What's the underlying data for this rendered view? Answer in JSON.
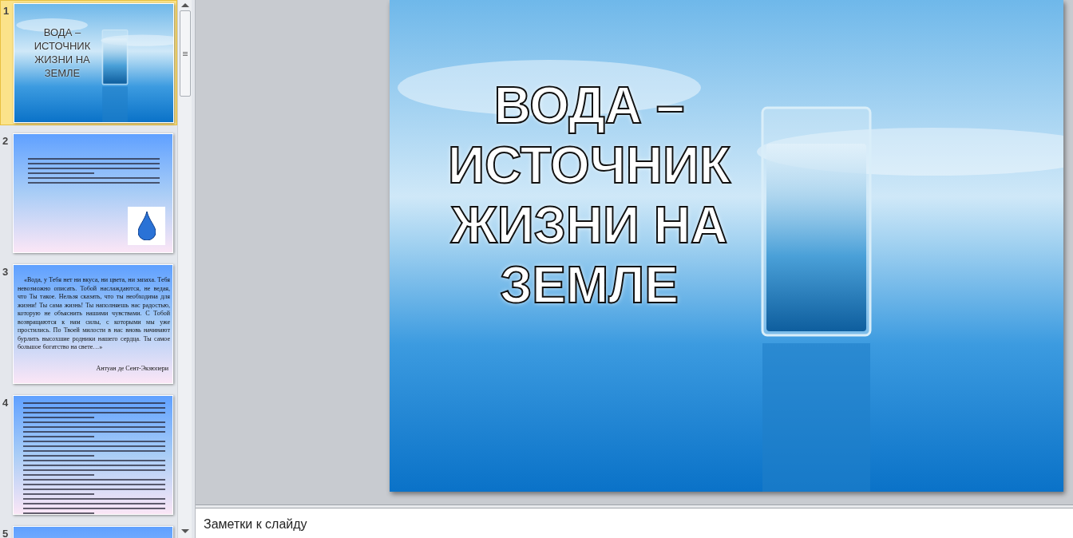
{
  "slides": [
    {
      "number": "1",
      "selected": true,
      "kind": "title",
      "title_lines": [
        "ВОДА –",
        "ИСТОЧНИК",
        "ЖИЗНИ НА",
        "ЗЕМЛЕ"
      ]
    },
    {
      "number": "2",
      "selected": false,
      "kind": "goals"
    },
    {
      "number": "3",
      "selected": false,
      "kind": "quote",
      "quote": "«Вода, у Тебя нет ни вкуса, ни цвета, ни запаха. Тебя невозможно описать. Тобой наслаждаются, не ведая, что Ты такое. Нельзя сказать, что ты необходима для жизни! Ты сама жизнь! Ты наполняешь нас радостью, которую не объяснить нашими чувствами. С Тобой возвращаются к нам силы, с которыми мы уже простились. По Твоей милости в нас вновь начинают бурлить высохшие родники нашего сердца. Ты самое большое богатство на свете…»",
      "author": "Антуан де Сент-Экзюпери"
    },
    {
      "number": "4",
      "selected": false,
      "kind": "dense"
    },
    {
      "number": "5",
      "selected": false,
      "kind": "partial"
    }
  ],
  "current_slide": {
    "title_lines": [
      "ВОДА –",
      "ИСТОЧНИК",
      "ЖИЗНИ НА",
      "ЗЕМЛЕ"
    ]
  },
  "notes": {
    "placeholder": "Заметки к слайду"
  }
}
